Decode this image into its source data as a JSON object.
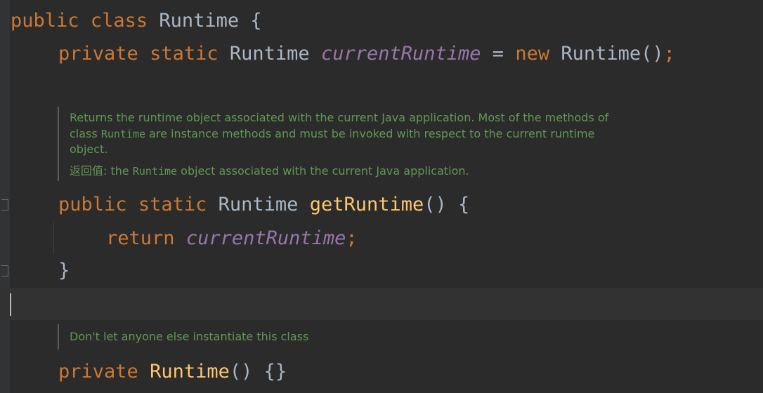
{
  "editor": {
    "line1": {
      "kw1": "public",
      "kw2": "class",
      "name": "Runtime",
      "brace": "{"
    },
    "line2": {
      "kw1": "private",
      "kw2": "static",
      "type": "Runtime",
      "field": "currentRuntime",
      "eq": "=",
      "kw3": "new",
      "ctor": "Runtime",
      "paren": "()",
      "semi": ";"
    },
    "doc1": {
      "text_a": "Returns the runtime object associated with the current Java application. Most of the methods of",
      "text_b_pre": "class ",
      "text_b_code": "Runtime",
      "text_b_post": " are instance methods and must be invoked with respect to the current runtime",
      "text_c": "object.",
      "return_label": "返回值:",
      "return_pre": " the ",
      "return_code": "Runtime",
      "return_post": " object associated with the current Java application."
    },
    "line3": {
      "kw1": "public",
      "kw2": "static",
      "type": "Runtime",
      "method": "getRuntime",
      "paren": "()",
      "brace": "{"
    },
    "line4": {
      "kw": "return",
      "field": "currentRuntime",
      "semi": ";"
    },
    "line5": {
      "brace": "}"
    },
    "doc2": {
      "text": "Don't let anyone else instantiate this class"
    },
    "line6": {
      "kw": "private",
      "method": "Runtime",
      "paren": "()",
      "braces": "{}"
    }
  },
  "colors": {
    "background": "#2b2b2b",
    "keyword": "#cc7832",
    "field": "#9876aa",
    "method": "#ffc66d",
    "text": "#a9b7c6",
    "doc": "#629755"
  }
}
